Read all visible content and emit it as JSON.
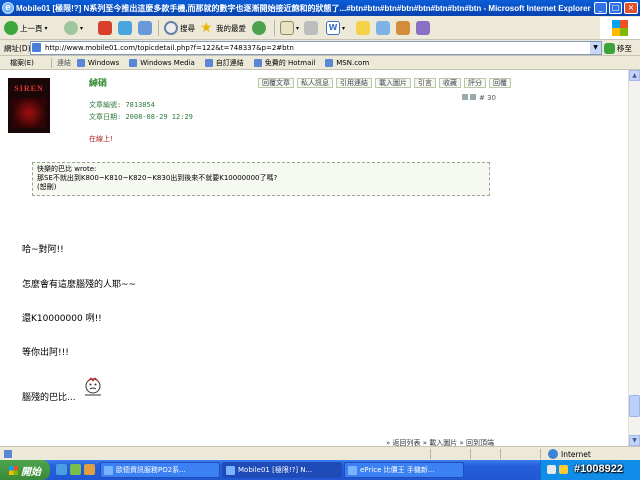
{
  "window": {
    "title": "Mobile01 [極限!?] N系列至今推出這麼多款手機,而那就的數字也逐漸開始接近飽和的狀態了...#btn#btn#btn#btn#btn#btn#btn#btn - Microsoft Internet Explorer",
    "app_icon": "ie-icon"
  },
  "toolbar": {
    "back_label": "上一頁",
    "search_label": "搜尋",
    "favorites_label": "我的最愛"
  },
  "address": {
    "label": "網址(D)",
    "url": "http://www.mobile01.com/topicdetail.php?f=122&t=748337&p=2#btn",
    "go_label": "移至"
  },
  "links": {
    "favorites": "檔案(E)",
    "links_label": "連結",
    "items": [
      "Windows",
      "Windows Media",
      "自訂連結",
      "免費的 Hotmail",
      "MSN.com"
    ]
  },
  "post": {
    "avatar_text": "SIREN",
    "username": "綽硝",
    "buttons": [
      "回覆文章",
      "私人訊息",
      "引用連結",
      "載入圖片",
      "引言",
      "收藏",
      "評分",
      "回覆"
    ],
    "article_id_label": "文章編號:",
    "article_id": "7813854",
    "date_label": "文章日期:",
    "date": "2008-08-29 12:29",
    "floor": "# 30",
    "online_status": "在線上!",
    "quote_author": "快樂的巴比 wrote:",
    "quote_text": "那SE不就出到K800~K810~K820~K830出到後來不就要K10000000了嗎?",
    "quote_tail": "(恕刪)",
    "lines": [
      "哈~對阿!!",
      "怎麼會有這麼腦殘的人耶~~",
      "還K10000000 咧!!",
      "等你出阿!!!",
      "腦殘的巴比..."
    ],
    "footer_links": "» 返回列表 » 載入圖片 » 回到頂端"
  },
  "status": {
    "zone": "Internet"
  },
  "taskbar": {
    "start_label": "開始",
    "tasks": [
      "歐德資訊服務PO2系...",
      "Mobile01 [極限!?] N...",
      "ePrice 比價王 手機新..."
    ],
    "watermark": "#1008922"
  },
  "colors": {
    "titlebar": "#0a5ed8",
    "username": "#2f8a2f",
    "online": "#b02020",
    "taskbar": "#245edb"
  }
}
